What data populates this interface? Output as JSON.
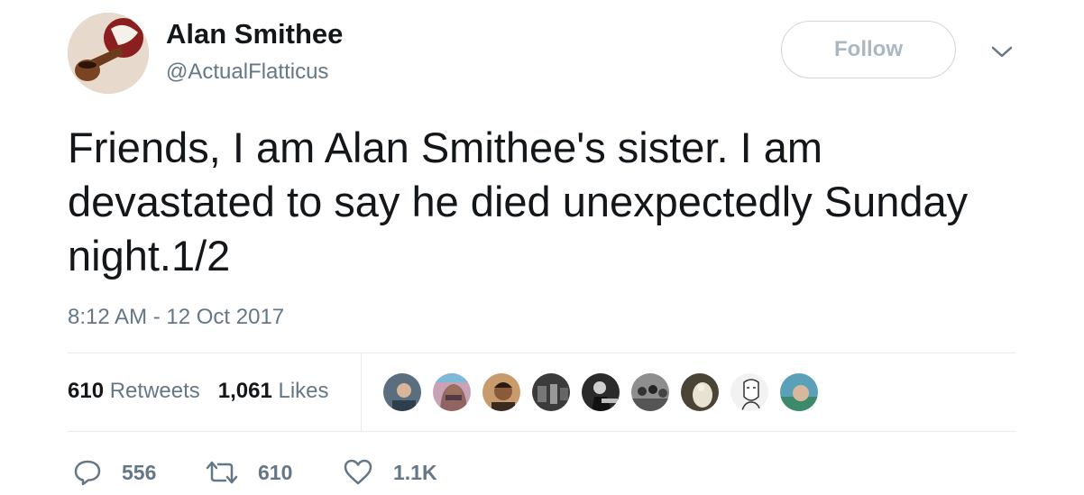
{
  "author": {
    "display_name": "Alan Smithee",
    "handle": "@ActualFlatticus",
    "avatar_icon": "pipe-avatar"
  },
  "header": {
    "follow_label": "Follow",
    "menu_icon": "chevron-down-icon"
  },
  "tweet": {
    "text": "Friends, I am Alan Smithee's sister. I am devastated to say he died unexpectedly Sunday night.1/2",
    "timestamp": "8:12 AM - 12 Oct 2017"
  },
  "stats": {
    "retweets_count": "610",
    "retweets_label": "Retweets",
    "likes_count": "1,061",
    "likes_label": "Likes",
    "liker_avatars": [
      {
        "color": "#5a6e7f"
      },
      {
        "color": "#a7899c"
      },
      {
        "color": "#c89b6c"
      },
      {
        "color": "#3b3b3b"
      },
      {
        "color": "#4a4a4a"
      },
      {
        "color": "#6d6d6d"
      },
      {
        "color": "#7b745e"
      },
      {
        "color": "#f2f2f2"
      },
      {
        "color": "#5aa0b8"
      }
    ]
  },
  "actions": {
    "reply_count": "556",
    "retweet_count": "610",
    "like_count": "1.1K"
  },
  "colors": {
    "text": "#14171a",
    "secondary": "#657786",
    "divider": "#e6ecf0",
    "follow_border": "#ccd6dd"
  }
}
